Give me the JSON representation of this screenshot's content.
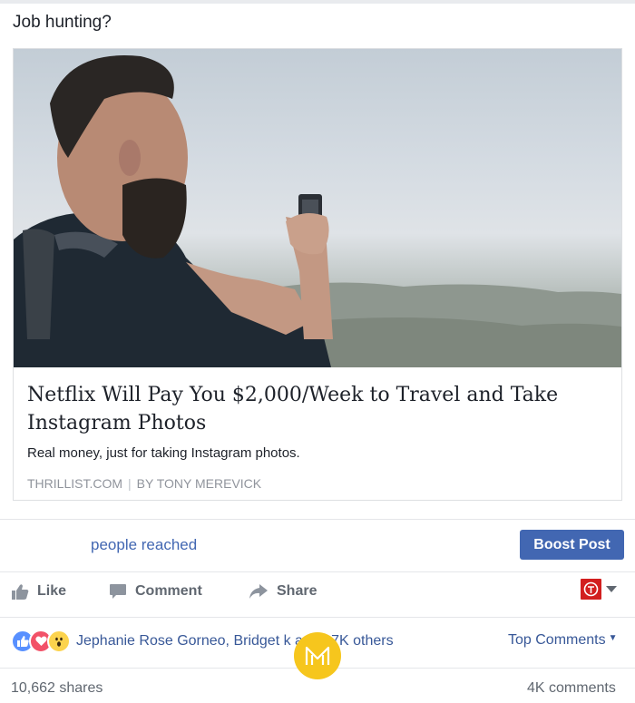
{
  "post": {
    "text": "Job hunting?"
  },
  "link_card": {
    "title": "Netflix Will Pay You $2,000/Week to Travel and Take Instagram Photos",
    "description": "Real money, just for taking Instagram photos.",
    "source": "THRILLIST.COM",
    "author": "BY TONY MEREVICK"
  },
  "insights": {
    "reach_label": "people reached",
    "boost_label": "Boost Post"
  },
  "actions": {
    "like": "Like",
    "comment": "Comment",
    "share": "Share"
  },
  "reactions": {
    "icons": [
      "like-reaction-icon",
      "love-reaction-icon",
      "wow-reaction-icon"
    ],
    "names": "Jephanie Rose Gorneo, Bridget",
    "names_tail": "k and 17K others",
    "sort_label": "Top Comments"
  },
  "stats": {
    "shares": "10,662 shares",
    "comments": "4K comments"
  },
  "colors": {
    "accent": "#4267b2",
    "link": "#385898",
    "like_blue": "#5890ff",
    "love_red": "#f25268",
    "wow_yellow": "#fcd34d",
    "page_avatar_red": "#d21f1f",
    "watermark_yellow": "#f6c61d"
  }
}
